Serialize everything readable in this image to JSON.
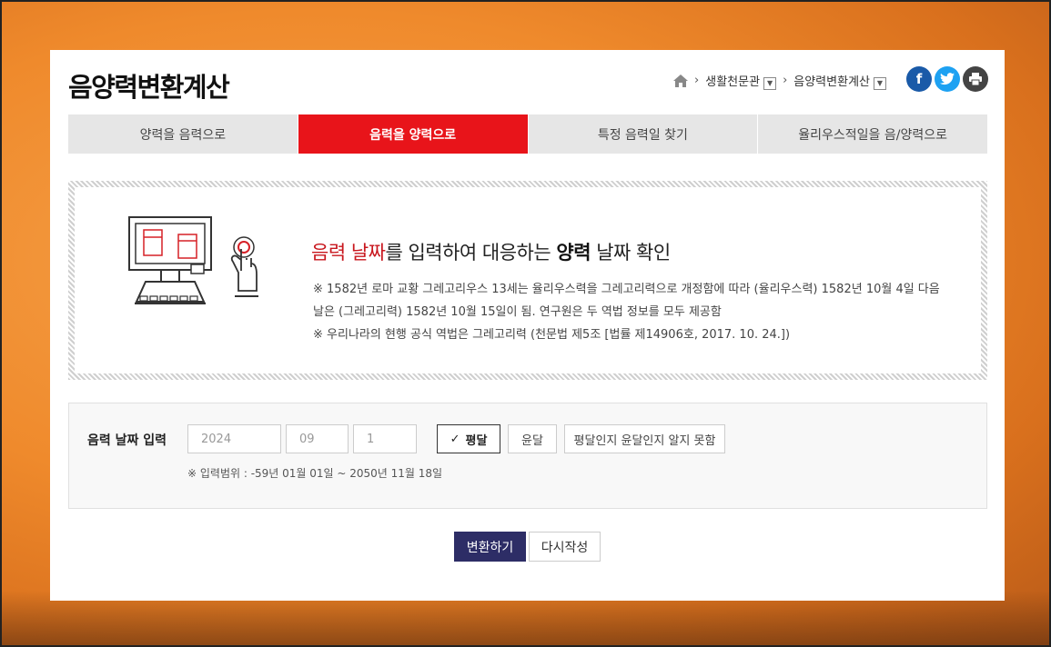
{
  "header": {
    "title": "음양력변환계산",
    "breadcrumb": [
      "생활천문관",
      "음양력변환계산"
    ],
    "share": [
      {
        "name": "facebook",
        "glyph": "f",
        "color": "#1a5aa8"
      },
      {
        "name": "twitter",
        "glyph": "t",
        "color": "#1da1f2"
      },
      {
        "name": "print",
        "glyph": "print-icon",
        "color": "#444444"
      }
    ]
  },
  "tabs": [
    {
      "label": "양력을 음력으로",
      "active": false
    },
    {
      "label": "음력을 양력으로",
      "active": true
    },
    {
      "label": "특정 음력일 찾기",
      "active": false
    },
    {
      "label": "율리우스적일을 음/양력으로",
      "active": false
    }
  ],
  "info": {
    "headline_part1": "음력 날짜",
    "headline_part2": "를 입력하여 대응하는 ",
    "headline_part3": "양력",
    "headline_part4": " 날짜 확인",
    "note1": "※ 1582년 로마 교황 그레고리우스 13세는 율리우스력을 그레고리력으로 개정함에 따라 (율리우스력) 1582년 10월 4일 다음 날은 (그레고리력) 1582년 10월 15일이 됨. 연구원은 두 역법 정보를 모두 제공함",
    "note2": "※ 우리나라의 현행 공식 역법은 그레고리력 (천문법 제5조 [법률 제14906호, 2017. 10. 24.])"
  },
  "form": {
    "label": "음력 날짜 입력",
    "year": "2024",
    "month": "09",
    "day": "1",
    "options": {
      "normal": "평달",
      "leap": "윤달",
      "unknown": "평달인지 윤달인지 알지 못함"
    },
    "selected": "normal",
    "range_note": "※ 입력범위 : -59년 01월 01일 ~ 2050년 11월 18일"
  },
  "actions": {
    "convert": "변환하기",
    "reset": "다시작성"
  },
  "colors": {
    "accent_red": "#e8141a",
    "convert_navy": "#2d2d66"
  }
}
